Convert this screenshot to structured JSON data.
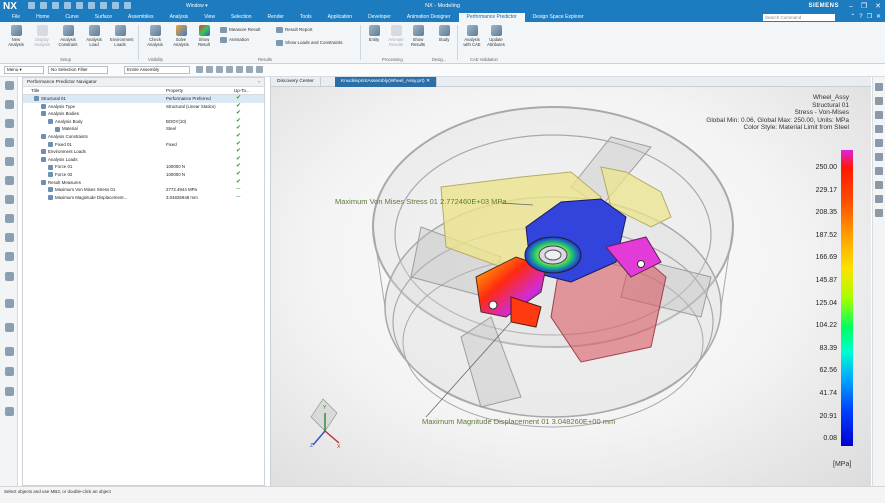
{
  "titlebar": {
    "logo": "NX",
    "window_menu": "Window ▾",
    "title": "NX - Modeling",
    "brand": "SIEMENS",
    "min": "–",
    "restore": "❐",
    "close": "✕"
  },
  "menubar": {
    "tabs": [
      {
        "label": "File"
      },
      {
        "label": "Home"
      },
      {
        "label": "Curve"
      },
      {
        "label": "Surface"
      },
      {
        "label": "Assemblies"
      },
      {
        "label": "Analysis"
      },
      {
        "label": "View"
      },
      {
        "label": "Selection"
      },
      {
        "label": "Render"
      },
      {
        "label": "Tools"
      },
      {
        "label": "Application"
      },
      {
        "label": "Developer"
      },
      {
        "label": "Animation Designer"
      },
      {
        "label": "Performance Predictor"
      },
      {
        "label": "Design Space Explorer"
      }
    ],
    "search_placeholder": "Search Command"
  },
  "ribbon": {
    "buttons": [
      {
        "label": "New Analysis"
      },
      {
        "label": "Display Analysis"
      },
      {
        "label": "Analysis Constraint"
      },
      {
        "label": "Analysis Load"
      },
      {
        "label": "Environment Loads"
      },
      {
        "label": "Check Analysis"
      },
      {
        "label": "Solve Analysis"
      },
      {
        "label": "Show Result"
      },
      {
        "label": "Result Settings"
      },
      {
        "label": "Entity"
      },
      {
        "label": "Animate Results"
      },
      {
        "label": "Show Results"
      },
      {
        "label": "Study"
      },
      {
        "label": "Analysis with CAE"
      },
      {
        "label": "Update Attributes"
      }
    ],
    "small": {
      "measure": "Measure Result",
      "animation": "Animation",
      "report": "Result Report",
      "show_loads": "Show Loads and Constraints"
    },
    "groups": {
      "setup": "Setup",
      "visibility": "Visibility",
      "results": "Results",
      "processing": "Processing",
      "design": "Desig...",
      "cae": "CAE Validation"
    }
  },
  "toolbar2": {
    "menu": "Menu ▾",
    "filter": "No Selection Filter",
    "assembly": "Entire Assembly"
  },
  "navigator": {
    "title": "Performance Predictor Navigator",
    "columns": {
      "name": "Title",
      "property": "Property",
      "status": "Up-To..."
    },
    "rows": [
      {
        "name": "Structural 01",
        "value": "Performance Preferred",
        "ok": true,
        "indent": 1,
        "selected": true
      },
      {
        "name": "Analysis Type",
        "value": "Structural (Linear Statics)",
        "ok": true,
        "indent": 2
      },
      {
        "name": "Analysis Bodies",
        "value": "",
        "ok": true,
        "indent": 2
      },
      {
        "name": "Analysis Body",
        "value": "BODY(10)",
        "ok": true,
        "indent": 3
      },
      {
        "name": "Material",
        "value": "Steel",
        "ok": true,
        "indent": 4
      },
      {
        "name": "Analysis Constraints",
        "value": "",
        "ok": true,
        "indent": 2
      },
      {
        "name": "Fixed 01",
        "value": "Fixed",
        "ok": true,
        "indent": 3
      },
      {
        "name": "Environment Loads",
        "value": "",
        "ok": true,
        "indent": 2
      },
      {
        "name": "Analysis Loads",
        "value": "",
        "ok": true,
        "indent": 2
      },
      {
        "name": "Force 01",
        "value": "100000 N",
        "ok": true,
        "indent": 3
      },
      {
        "name": "Force 02",
        "value": "100000 N",
        "ok": true,
        "indent": 3
      },
      {
        "name": "Result Measures",
        "value": "",
        "ok": true,
        "indent": 2
      },
      {
        "name": "Maximum Von Mises Stress 01",
        "value": "2772.4944 MPa",
        "ok": false,
        "indent": 3
      },
      {
        "name": "Maximum Magnitude Displacement...",
        "value": "3.04826948 mm",
        "ok": false,
        "indent": 3
      }
    ]
  },
  "viewport": {
    "tabs": [
      {
        "label": "Discovery Center"
      },
      {
        "label": "KnuckleprintAssembly(Wheel_Assy.prt)"
      }
    ],
    "info": [
      "Wheel_Assy",
      "Structural 01",
      "Stress - Von-Mises",
      "Global Min: 0.06, Global Max: 250.00, Units: MPa",
      "Color Style: Material Limit from Steel"
    ],
    "legend_values": [
      "250.00",
      "229.17",
      "208.35",
      "187.52",
      "166.69",
      "145.87",
      "125.04",
      "104.22",
      "83.39",
      "62.56",
      "41.74",
      "20.91",
      "0.08"
    ],
    "units": "[MPa]",
    "annotation_stress": "Maximum Von Mises Stress 01 2.772460E+03 MPa",
    "annotation_disp": "Maximum Magnitude Displacement 01 3.048260E+00 mm",
    "axes": {
      "x": "X",
      "y": "Y",
      "z": "Z"
    }
  },
  "statusbar": {
    "text": "Select objects and use MB3, or double-click an object"
  },
  "colors": {
    "accent": "#1d7bbf",
    "ok": "#2b9a2b"
  }
}
